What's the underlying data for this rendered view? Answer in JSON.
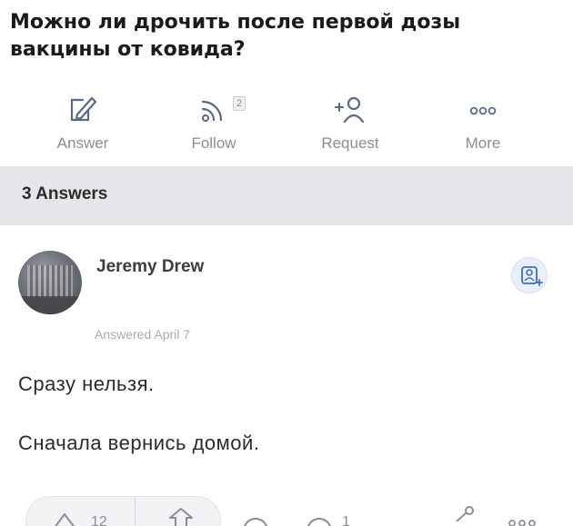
{
  "question": {
    "title": "Можно ли дрочить после первой дозы вакцины от ковида?"
  },
  "actions": [
    {
      "label": "Answer",
      "icon": "pencil-square-icon"
    },
    {
      "label": "Follow",
      "icon": "rss-icon",
      "badge": "2"
    },
    {
      "label": "Request",
      "icon": "person-plus-icon"
    },
    {
      "label": "More",
      "icon": "ellipsis-icon"
    }
  ],
  "answers": {
    "count_label": "3 Answers"
  },
  "answer": {
    "author": "Jeremy Drew",
    "date": "Answered April 7",
    "text_line_1": "Сразу нельзя.",
    "text_line_2": "Сначала вернись домой."
  },
  "bottom": {
    "upvotes": "12",
    "comments": "1"
  },
  "colors": {
    "accent": "#3f6cc4",
    "muted": "#8a8d91",
    "bar_bg": "#e4e6e9"
  }
}
